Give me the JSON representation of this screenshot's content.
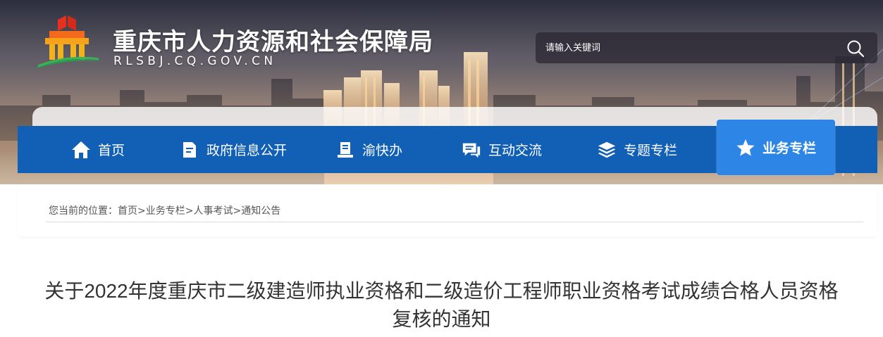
{
  "header": {
    "site_title": "重庆市人力资源和社会保障局",
    "site_domain": "RLSBJ.CQ.GOV.CN",
    "search": {
      "placeholder": "请输入关键词",
      "icon": "search-icon"
    }
  },
  "nav": {
    "items": [
      {
        "label": "首页",
        "icon": "home-icon",
        "active": false
      },
      {
        "label": "政府信息公开",
        "icon": "document-icon",
        "active": false
      },
      {
        "label": "渝快办",
        "icon": "service-icon",
        "active": false
      },
      {
        "label": "互动交流",
        "icon": "chat-icon",
        "active": false
      },
      {
        "label": "专题专栏",
        "icon": "layers-icon",
        "active": false
      },
      {
        "label": "业务专栏",
        "icon": "star-icon",
        "active": true
      }
    ],
    "colors": {
      "bar": "#1160b5",
      "active": "#2d86e6"
    }
  },
  "breadcrumb": {
    "prefix": "您当前的位置：",
    "items": [
      "首页",
      "业务专栏",
      "人事考试",
      "通知公告"
    ],
    "separator": ">"
  },
  "article": {
    "title": "关于2022年度重庆市二级建造师执业资格和二级造价工程师职业资格考试成绩合格人员资格复核的通知"
  }
}
